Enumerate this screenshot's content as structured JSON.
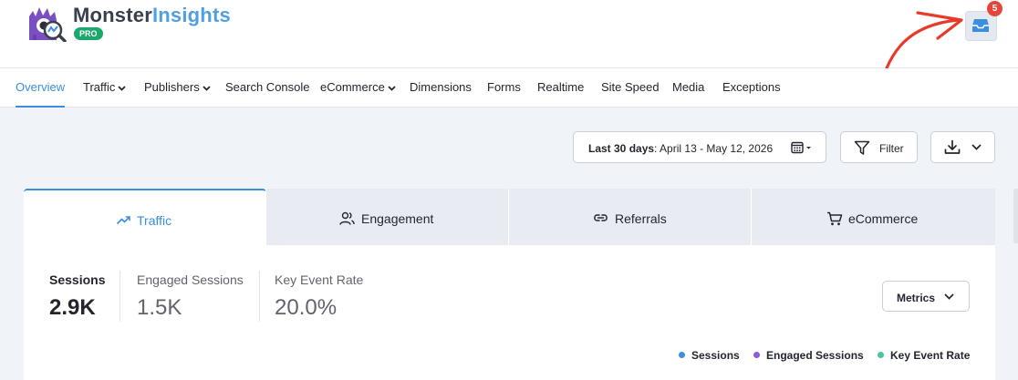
{
  "header": {
    "brand_part1": "Monster",
    "brand_part2": "Insights",
    "badge": "PRO",
    "notification_count": "5",
    "colors": {
      "accent": "#3b8ee0",
      "badge_green": "#1ba86a",
      "alert_red": "#e6453b"
    }
  },
  "nav": {
    "items": [
      {
        "label": "Overview",
        "active": true
      },
      {
        "label": "Traffic",
        "dropdown": true
      },
      {
        "label": "Publishers",
        "dropdown": true
      },
      {
        "label": "Search Console"
      },
      {
        "label": "eCommerce",
        "dropdown": true
      },
      {
        "label": "Dimensions"
      },
      {
        "label": "Forms"
      },
      {
        "label": "Realtime"
      },
      {
        "label": "Site Speed"
      },
      {
        "label": "Media"
      },
      {
        "label": "Exceptions"
      }
    ]
  },
  "toolbar": {
    "date_prefix": "Last 30 days",
    "date_range": ": April 13 - May 12, 2026",
    "filter_label": "Filter",
    "icons": [
      "calendar-icon",
      "filter-icon",
      "download-icon"
    ]
  },
  "report": {
    "tabs": [
      {
        "label": "Traffic",
        "icon": "trend-icon",
        "active": true
      },
      {
        "label": "Engagement",
        "icon": "users-icon"
      },
      {
        "label": "Referrals",
        "icon": "link-icon"
      },
      {
        "label": "eCommerce",
        "icon": "cart-icon"
      }
    ],
    "metrics": [
      {
        "label": "Sessions",
        "value": "2.9K",
        "active": true
      },
      {
        "label": "Engaged Sessions",
        "value": "1.5K"
      },
      {
        "label": "Key Event Rate",
        "value": "20.0%"
      }
    ],
    "metrics_button": "Metrics",
    "legend": [
      {
        "label": "Sessions",
        "color": "#3b8ee0"
      },
      {
        "label": "Engaged Sessions",
        "color": "#8d5cd6"
      },
      {
        "label": "Key Event Rate",
        "color": "#4cc59a"
      }
    ]
  }
}
